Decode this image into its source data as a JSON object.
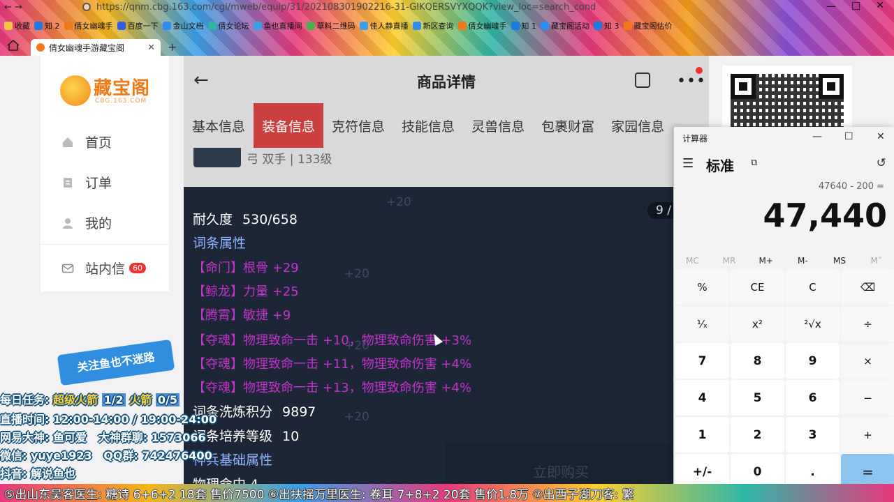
{
  "browser": {
    "url": "https://qnm.cbg.163.com/cgi/mweb/equip/31/202108301902216-31-GIKQERSVYXQQK?view_loc=search_cond",
    "window_controls": [
      "一",
      "□",
      "✕"
    ],
    "bookmarks": [
      "收藏",
      "知 2",
      "倩女幽魂手",
      "百度一下",
      "金山文档",
      "倩女论坛",
      "鱼也直播间",
      "草料二维码",
      "佳人静直播",
      "新区查询",
      "倩女幽魂手",
      "知 1",
      "藏宝阁活动",
      "知 3",
      "藏宝阁估价"
    ],
    "tab_title": "倩女幽魂手游藏宝阁",
    "tab_close": "✕",
    "new_tab": "+"
  },
  "sidebar": {
    "logo_text": "藏宝阁",
    "logo_domain": "CBG.163.COM",
    "items": [
      {
        "label": "首页"
      },
      {
        "label": "订单"
      },
      {
        "label": "我的"
      },
      {
        "label": "站内信",
        "badge": "60"
      }
    ]
  },
  "mobile": {
    "back_glyph": "←",
    "title": "商品详情",
    "more_glyph": "•••",
    "tabs": [
      "基本信息",
      "装备信息",
      "克符信息",
      "技能信息",
      "灵兽信息",
      "包裹财富",
      "家园信息"
    ],
    "active_tab": "装备信息",
    "item_subtitle": "弓 双手 | 133级",
    "pager": "9 /",
    "ghost_texts": [
      "+20",
      "+20",
      "+20",
      "+20"
    ],
    "lines": [
      {
        "label": "耐久度",
        "value": "530/658"
      },
      {
        "label": "词条属性"
      },
      {
        "text": "【命门】根骨 +29"
      },
      {
        "text": "【鲸龙】力量 +25"
      },
      {
        "text": "【腾霄】敏捷 +9"
      },
      {
        "text": "【夺魂】物理致命一击 +10，物理致命伤害 +3%"
      },
      {
        "text": "【夺魂】物理致命一击 +11，物理致命伤害 +4%"
      },
      {
        "text": "【夺魂】物理致命一击 +13，物理致命伤害 +4%"
      },
      {
        "label": "词条洗炼积分",
        "value": "9897"
      },
      {
        "label": "词条培养等级",
        "value": "10"
      },
      {
        "label": "神兵基础属性"
      },
      {
        "label": "物理命中 4"
      }
    ],
    "buy_label": "立即购买"
  },
  "calculator": {
    "app_title": "计算器",
    "window_controls": [
      "—",
      "☐",
      "✕"
    ],
    "menu_glyph": "☰",
    "mode": "标准",
    "keep_on_top_glyph": "⧉",
    "history_glyph": "↺",
    "expression": "47640 - 200 =",
    "result": "47,440",
    "memory": [
      "MC",
      "MR",
      "M+",
      "M-",
      "MS",
      "M˅"
    ],
    "keys": [
      "%",
      "CE",
      "C",
      "⌫",
      "¹⁄ₓ",
      "x²",
      "²√x",
      "÷",
      "7",
      "8",
      "9",
      "×",
      "4",
      "5",
      "6",
      "−",
      "1",
      "2",
      "3",
      "+",
      "+/-",
      "0",
      ".",
      "="
    ]
  },
  "overlay": {
    "bubble": "关注鱼也不迷路",
    "task_label": "每日任务:",
    "task_1": "超级火箭",
    "task_1_count": "1/2",
    "task_2": "火箭",
    "task_2_count": "0/5",
    "live_time": "直播时间: 12:00-14:00 / 19:00-24:00",
    "netease_god": "网易大神: 鱼可爱",
    "god_group": "大神群聊: 1573066",
    "wechat": "微信: yuye1923",
    "qq_group": "QQ群: 742476400",
    "douyin": "抖音: 解说鱼也",
    "ticker": "⑤出山东吴客医生: 糖诗 6+6+2 18套 售价7500   ⑥出扶摇万里医生: 卷耳 7+8+2 20套 售价1.8万   ⑦出西子湖刀客: 繁"
  }
}
